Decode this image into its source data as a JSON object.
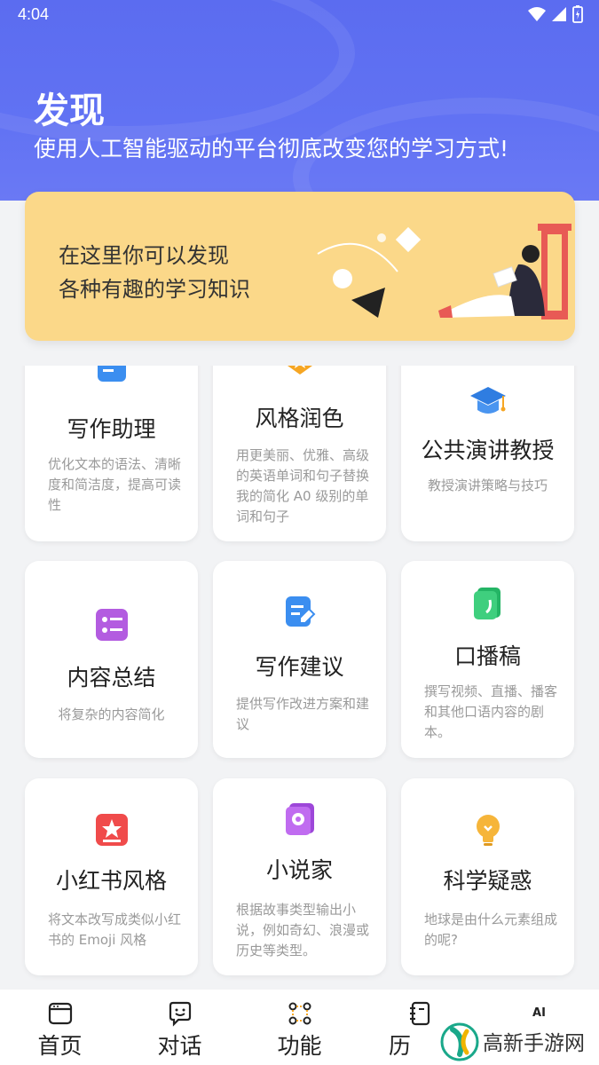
{
  "status_bar": {
    "time": "4:04"
  },
  "header": {
    "title": "发现",
    "subtitle": "使用人工智能驱动的平台彻底改变您的学习方式!"
  },
  "banner": {
    "line1": "在这里你可以发现",
    "line2": "各种有趣的学习知识"
  },
  "cards": [
    {
      "title": "写作助理",
      "desc": "优化文本的语法、清晰度和简洁度，提高可读性",
      "icon": "pencil-doc-icon"
    },
    {
      "title": "风格润色",
      "desc": "用更美丽、优雅、高级的英语单词和句子替换我的简化 A0 级别的单词和句子",
      "icon": "star-badge-icon"
    },
    {
      "title": "公共演讲教授",
      "desc": "教授演讲策略与技巧",
      "icon": "graduation-cap-icon"
    },
    {
      "title": "内容总结",
      "desc": "将复杂的内容简化",
      "icon": "checklist-icon"
    },
    {
      "title": "写作建议",
      "desc": "提供写作改进方案和建议",
      "icon": "edit-document-icon"
    },
    {
      "title": "口播稿",
      "desc": "撰写视频、直播、播客和其他口语内容的剧本。",
      "icon": "script-book-icon"
    },
    {
      "title": "小红书风格",
      "desc": "将文本改写成类似小红书的 Emoji 风格",
      "icon": "red-star-note-icon"
    },
    {
      "title": "小说家",
      "desc": "根据故事类型输出小说，例如奇幻、浪漫或历史等类型。",
      "icon": "flower-book-icon"
    },
    {
      "title": "科学疑惑",
      "desc": "地球是由什么元素组成的呢?",
      "icon": "lightbulb-icon"
    }
  ],
  "tabs": [
    {
      "label": "首页",
      "icon": "home-window-icon"
    },
    {
      "label": "对话",
      "icon": "chat-bubble-icon"
    },
    {
      "label": "功能",
      "icon": "function-nodes-icon"
    },
    {
      "label": "历",
      "icon": "history-book-icon"
    },
    {
      "label": "",
      "icon": "ai-icon"
    }
  ],
  "ai_badge": "AI",
  "watermark": "高新手游网",
  "colors": {
    "header": "#5b6cf0",
    "banner": "#fbd889",
    "accent_blue": "#3b8ef0"
  }
}
